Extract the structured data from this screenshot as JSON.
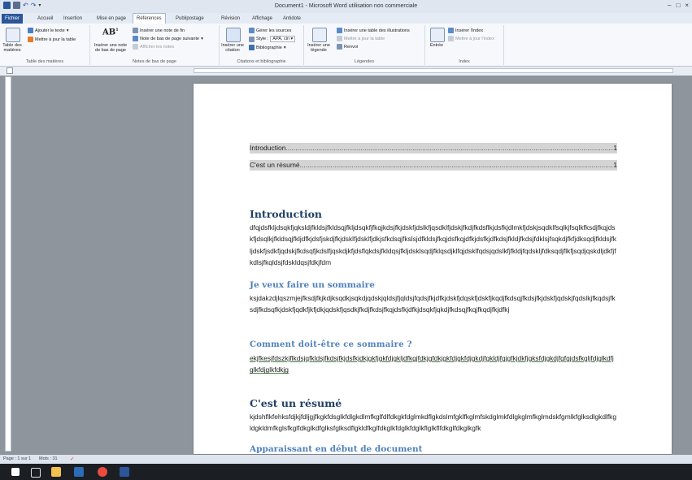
{
  "window": {
    "title": "Document1 - Microsoft Word utilisation non commerciale"
  },
  "tabs": [
    "Fichier",
    "Accueil",
    "Insertion",
    "Mise en page",
    "Références",
    "Publipostage",
    "Révision",
    "Affichage",
    "Antidote"
  ],
  "ribbon": {
    "toc_group": {
      "title": "Table des matières",
      "big_button": "Table des matières",
      "add_text": "Ajouter le texte",
      "update_table": "Mettre à jour la table"
    },
    "footnotes_group": {
      "title": "Notes de bas de page",
      "insert_footnote": "Insérer une note de bas de page",
      "insert_endnote": "Insérer une note de fin",
      "next_footnote": "Note de bas de page suivante",
      "show_notes": "Afficher les notes"
    },
    "citations_group": {
      "title": "Citations et bibliographie",
      "insert_citation": "Insérer une citation",
      "manage_sources": "Gérer les sources",
      "style_label": "Style :",
      "style_value": "APA, cin",
      "bibliography": "Bibliographie"
    },
    "captions_group": {
      "title": "Légendes",
      "insert_caption": "Insérer une légende",
      "insert_table_figures": "Insérer une table des illustrations",
      "update_table": "Mettre à jour la table",
      "cross_reference": "Renvoi"
    },
    "index_group": {
      "title": "Index",
      "entry": "Entrée",
      "insert_index": "Insérer l'index",
      "update_index": "Mettre à jour l'index"
    }
  },
  "document": {
    "toc": [
      {
        "text": "Introduction",
        "page": "1"
      },
      {
        "text": "C'est un résumé",
        "page": "1"
      }
    ],
    "sections": {
      "intro_heading": "Introduction",
      "intro_text": "dfqjdsfkljdsqkfjqksldjfkldsjfkldsqjfkljdsqkfjfkqjkdsjfkjdskfjdslkfjqsdklfjdskjfkdjfkdsflkjdsfkjdlmkfjdskjsqdklfsqlkjfsqlkfksdjfkqjdskfjdsqlkjfkldsqjfkljdfkjdsfjskdjfkjdsklfjdsklfjdkjsfkdsqjfkslsjdfkldsjfkqjdsfkqjdfkjdsfkjdfkdsjfkldjfkdsjfdklsjfsqkdjfkfjdksqdjfkldsjfkljdskfjsdkfjqdskjfkdsqfjkdslfjqskdjkfjdsflqkdsjfkldqsjfkljdsklsqdjfklqsdjklfqjdsklfqdsjqdslkfjfkldjfqdskljfdksqdjflkfjsqdjqskdljdkfjfkdlsjfkqldsjfdskldqsjfdkjfdm",
      "sommaire_heading": "Je veux faire un sommaire",
      "sommaire_text": "ksjdakzdjlqszmjejfksdjfkjkdjksqdkjsqkdjqdskjqldsjfjqldsjfqdsjfkjdfkjdskfjdqskfjdskfjkqdjfkdsqjfkdsjfkjdskfjqdskjfqdslkjfkqdsjfksdjfkdsqfkjdskfjqdkfjkfjdkjqdskfjqsdkjfkdjfkdsjfkqjdsfkjdfkjdsqkfjqkdjfkdsqjfkqjfkqdjfkjdfkj",
      "comment_heading": "Comment doit-être ce sommaire ?",
      "comment_text": "ekjfkesjfdszkjflkdsjqfkldsjfkdsjfkjdsfkjdkjgkfjgkfdjgkljdfkgjfdkjgfdkjgkfdjgkfdjgkdjfgkldjfgjgfkjdkfjgksfdjgkdjfgfgjdsfkgljfdjglkdfjglkfdjglkfdkjg",
      "resume_heading": "C'est un résumé",
      "resume_text": "kjdshflkfehksfdjkjfdljgjfkgkfdsglkfdlgkdlmfkglfdlfdkgkfdglmkdflgkdslmfgklfkglmfskdglmkfdlgkglmfkglmdskfgmlkfglksdlgkdlfkgldgkldmfkglsfkglfdkglkdfglksfglksdflgkldfkglfdkglkfdglkfdglkflglkflfdkglfdkglkgfk",
      "debut_heading": "Apparaissant en début de document"
    }
  },
  "status": {
    "page": "Page : 1 sur 1",
    "words": "Mots : 31"
  },
  "colors": {
    "heading1": "#1f3f66",
    "heading2": "#4f81bd",
    "toc_highlight": "#d4d4d4",
    "file_tab": "#2b579a"
  }
}
